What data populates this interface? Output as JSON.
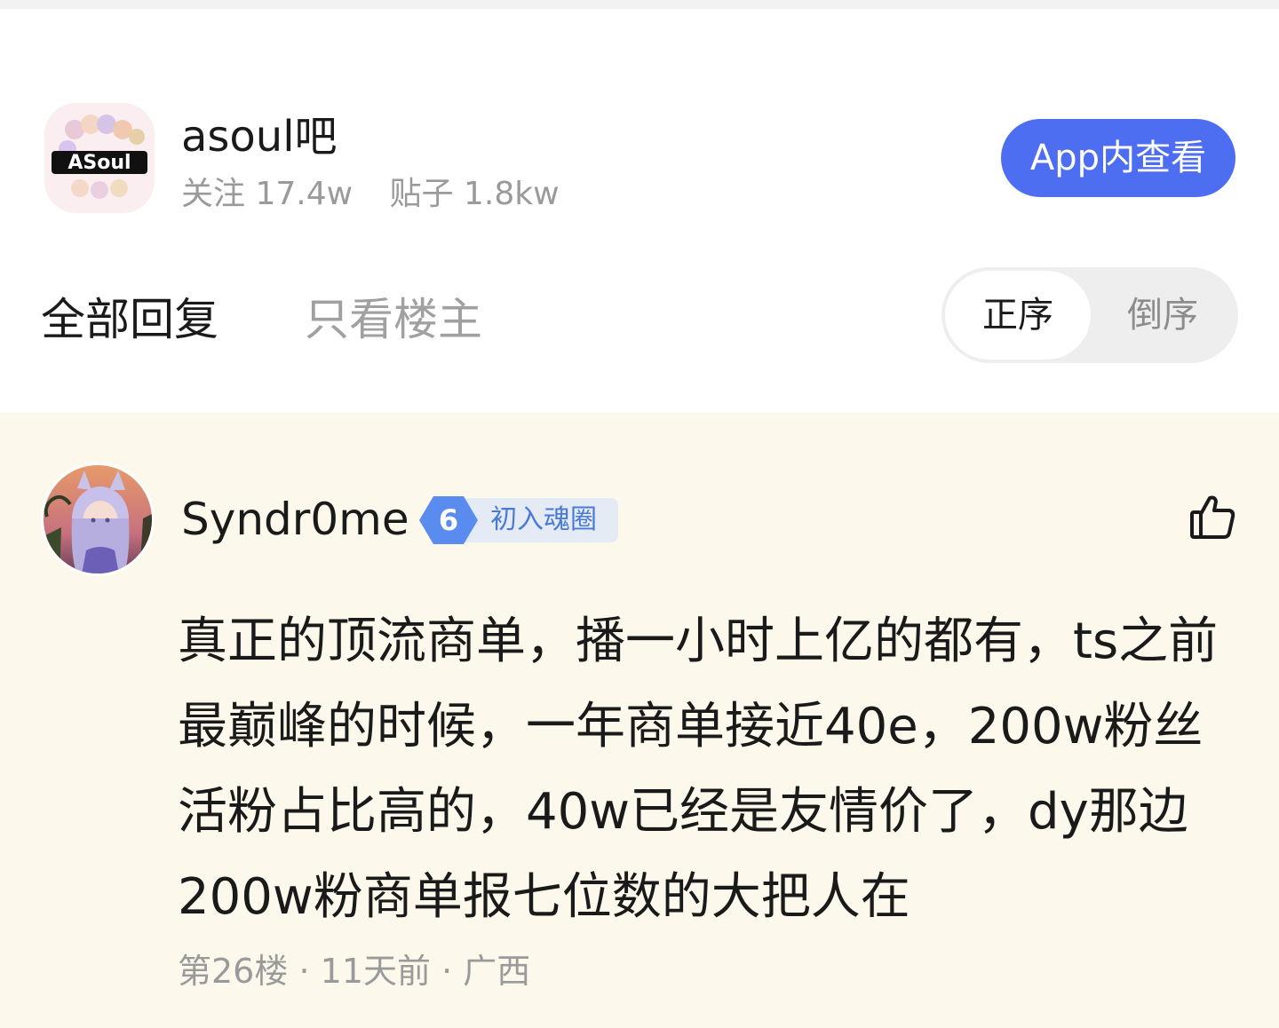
{
  "forum": {
    "name": "asoul吧",
    "follow_label": "关注",
    "follow_count": "17.4w",
    "posts_label": "贴子",
    "posts_count": "1.8kw",
    "app_button_label": "App内查看",
    "logo_text": "ASoul"
  },
  "filter": {
    "tab_all": "全部回复",
    "tab_op_only": "只看楼主",
    "order_asc": "正序",
    "order_desc": "倒序"
  },
  "reply": {
    "username": "Syndr0me",
    "level": "6",
    "level_title": "初入魂圈",
    "content": "真正的顶流商单，播一小时上亿的都有，ts之前最巅峰的时候，一年商单接近40e，200w粉丝活粉占比高的，40w已经是友情价了，dy那边200w粉商单报七位数的大把人在",
    "floor": "第26楼",
    "time": "11天前",
    "location": "广西",
    "separator": "·"
  },
  "colors": {
    "accent": "#4e6ef2",
    "reply_bg": "#fcf9ec",
    "level_badge": "#5a8cf0",
    "muted_text": "#9a9a9a"
  },
  "icons": {
    "like": "thumbs-up-icon",
    "level": "hexagon-level-icon"
  }
}
